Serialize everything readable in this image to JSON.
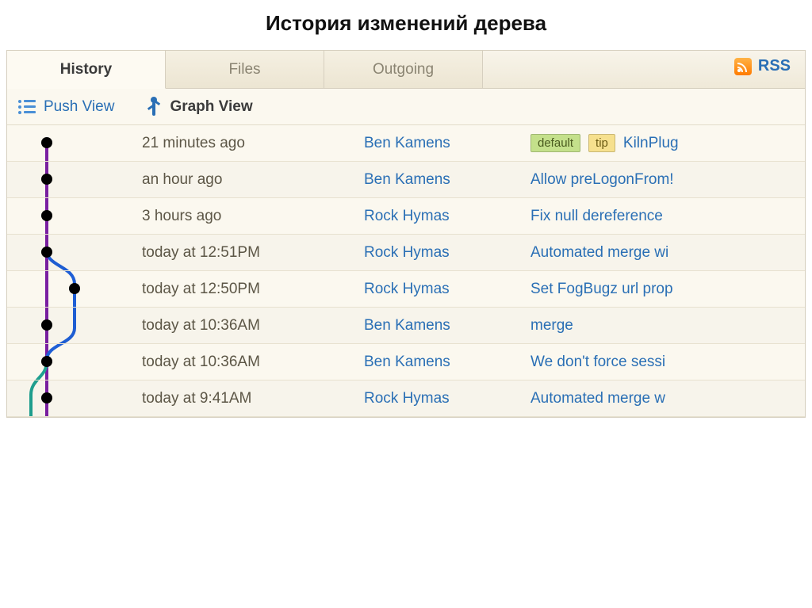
{
  "page_heading": "История изменений дерева",
  "tabs": {
    "history": "History",
    "files": "Files",
    "outgoing": "Outgoing"
  },
  "rss_label": "RSS",
  "view_options": {
    "push": "Push View",
    "graph": "Graph View"
  },
  "badges": {
    "default": "default",
    "tip": "tip"
  },
  "commits": [
    {
      "time": "21 minutes ago",
      "author": "Ben Kamens",
      "message": "KilnPlug",
      "show_badges": true
    },
    {
      "time": "an hour ago",
      "author": "Ben Kamens",
      "message": "Allow preLogonFrom!",
      "show_badges": false
    },
    {
      "time": "3 hours ago",
      "author": "Rock Hymas",
      "message": "Fix null dereference",
      "show_badges": false
    },
    {
      "time": "today at 12:51PM",
      "author": "Rock Hymas",
      "message": "Automated merge wi",
      "show_badges": false
    },
    {
      "time": "today at 12:50PM",
      "author": "Rock Hymas",
      "message": "Set FogBugz url prop",
      "show_badges": false
    },
    {
      "time": "today at 10:36AM",
      "author": "Ben Kamens",
      "message": "merge",
      "show_badges": false
    },
    {
      "time": "today at 10:36AM",
      "author": "Ben Kamens",
      "message": "We don't force sessi",
      "show_badges": false
    },
    {
      "time": "today at 9:41AM",
      "author": "Rock Hymas",
      "message": "Automated merge w",
      "show_badges": false
    }
  ],
  "colors": {
    "link": "#2a6fb5",
    "graph_main": "#7a1fa2",
    "graph_branch": "#1f5fd6",
    "graph_teal": "#1fa090",
    "badge_green": "#c4e08b",
    "badge_yellow": "#f6e08e"
  }
}
